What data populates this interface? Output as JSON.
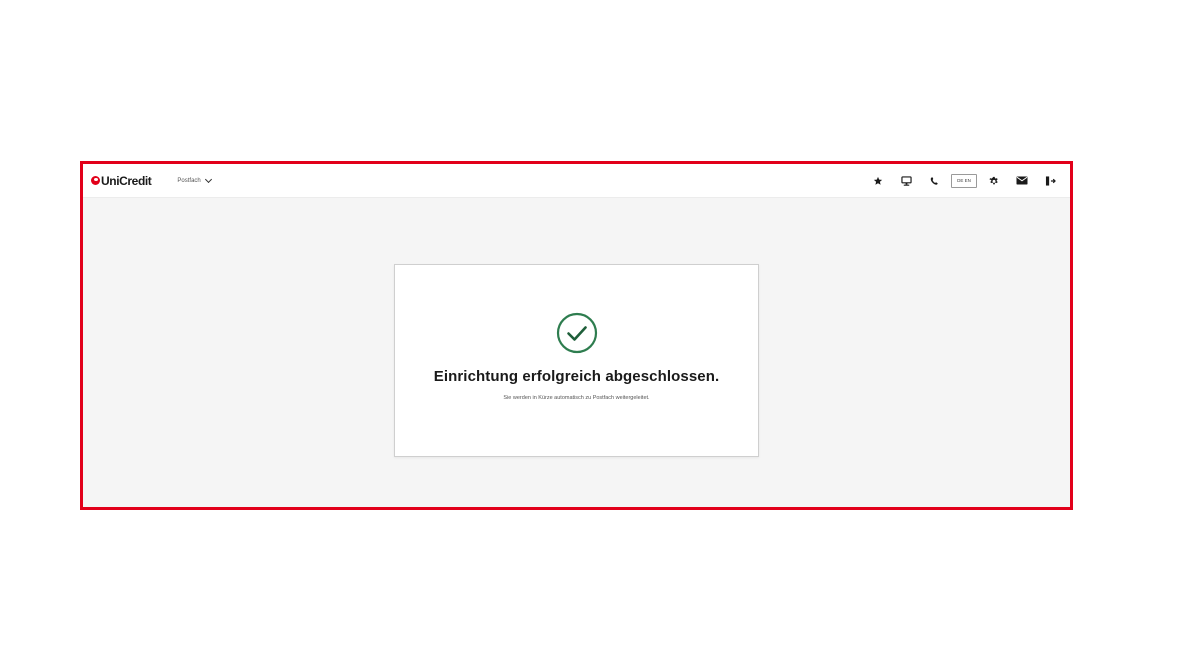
{
  "theme": {
    "frame_color": "#e2001a",
    "brand_red": "#e2001a",
    "success_green": "#2e7d4f"
  },
  "header": {
    "logo_text": "UniCredit",
    "dropdown_label": "Postfach",
    "actions": [
      {
        "icon": "star-icon"
      },
      {
        "icon": "monitor-icon"
      },
      {
        "icon": "phone-icon"
      },
      {
        "icon": "text-box",
        "label": "DE EN"
      },
      {
        "icon": "gear-icon"
      },
      {
        "icon": "mail-icon"
      },
      {
        "icon": "logout-icon"
      }
    ]
  },
  "card": {
    "status_icon": "check-circle-icon",
    "title": "Einrichtung erfolgreich abgeschlossen.",
    "subtitle": "Sie werden in Kürze automatisch zu Postfach weitergeleitet."
  }
}
